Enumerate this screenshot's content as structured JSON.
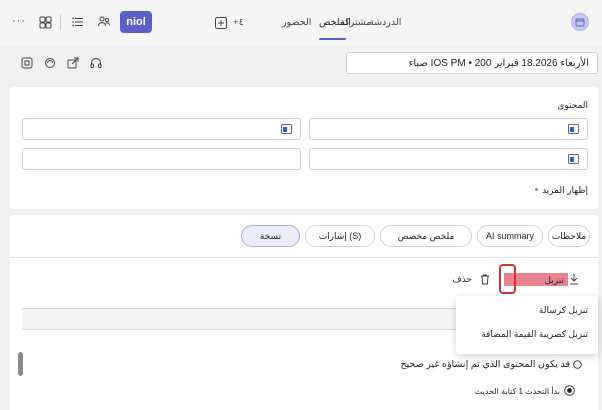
{
  "topbar": {
    "tabs": [
      {
        "label": "الدردشة"
      },
      {
        "label": "مشتركة"
      },
      {
        "label": "الملخص"
      },
      {
        "label": "الحضور"
      }
    ],
    "add_label": "+٤",
    "brand_label": "niol",
    "more_label": "···"
  },
  "date_line": "الأربعاء 18.2026 فبراير 200 • IOS PM صباء",
  "content_card": {
    "title": "المحتوى",
    "show_more": "إظهار المزيد"
  },
  "pills": [
    {
      "label": "ملاحظات"
    },
    {
      "label": "AI summary"
    },
    {
      "label": "ملخص مخصص"
    },
    {
      "label": "إشارات (S)"
    },
    {
      "label": "نسخة"
    }
  ],
  "actions": {
    "download_label": "تنزيل",
    "delete_label": "حذف"
  },
  "download_menu": {
    "items": [
      {
        "label": "تنزيل كرسالة"
      },
      {
        "label": "تنزيل كصريبة القيمة المضافة"
      }
    ]
  },
  "disclaimer": "قد يكون المحتوى الذي تم إنشاؤه غير صحيح",
  "transcript_entry": "بدأ التحدث 1 كتابة الحديث",
  "colors": {
    "accent": "#5b5fc7",
    "highlight": "#e46d7a",
    "focus_ring": "#d13438"
  }
}
